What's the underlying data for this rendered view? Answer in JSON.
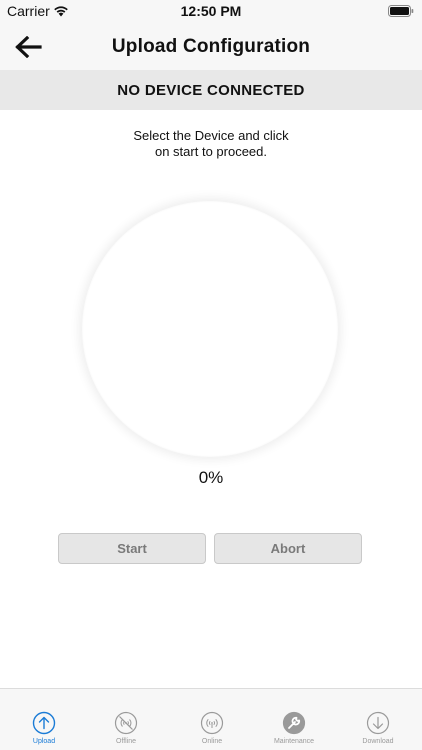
{
  "status_bar": {
    "carrier": "Carrier",
    "time": "12:50 PM"
  },
  "nav": {
    "title": "Upload Configuration",
    "back_icon": "arrow-left-icon"
  },
  "device_banner": "NO DEVICE CONNECTED",
  "instruction": {
    "line1": "Select the Device and click",
    "line2": "on start to proceed."
  },
  "progress": {
    "value": 0,
    "label": "0%"
  },
  "actions": {
    "start_label": "Start",
    "abort_label": "Abort"
  },
  "tabs": [
    {
      "label": "Upload",
      "icon": "upload-icon",
      "active": true
    },
    {
      "label": "Offline",
      "icon": "offline-icon",
      "active": false
    },
    {
      "label": "Online",
      "icon": "online-icon",
      "active": false
    },
    {
      "label": "Maintenance",
      "icon": "maintenance-icon",
      "active": false
    },
    {
      "label": "Download",
      "icon": "download-icon",
      "active": false
    }
  ],
  "colors": {
    "accent": "#1a7bd6",
    "inactive": "#9a9a9a",
    "banner_bg": "#e8e8e8",
    "button_bg": "#e6e6e6"
  }
}
